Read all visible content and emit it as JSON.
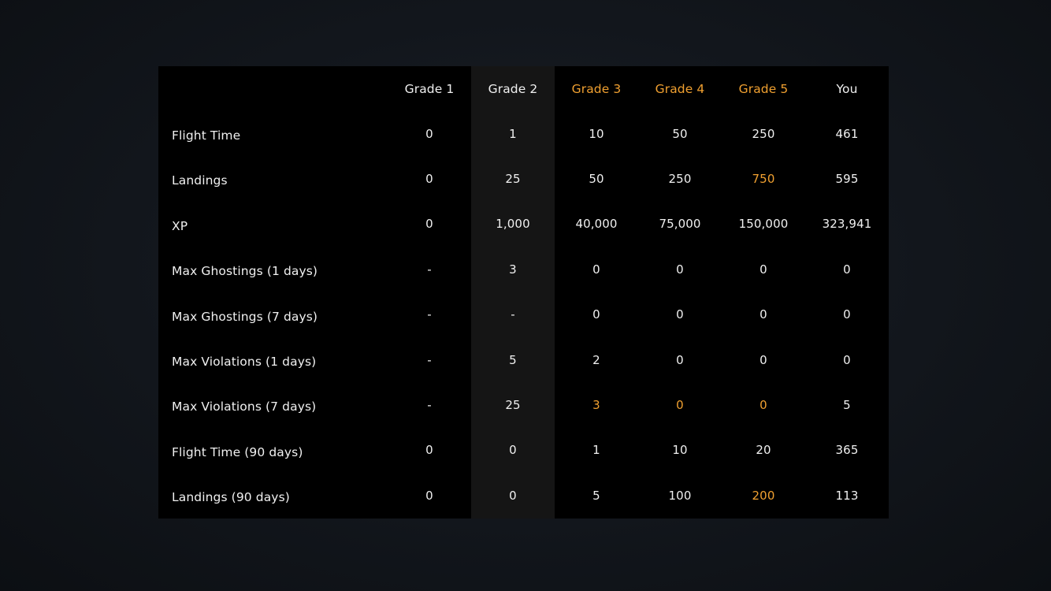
{
  "table": {
    "columns": [
      {
        "label": "Grade 1",
        "color": "#f0f0f0"
      },
      {
        "label": "Grade 2",
        "color": "#f0f0f0"
      },
      {
        "label": "Grade 3",
        "color": "#f0a030"
      },
      {
        "label": "Grade 4",
        "color": "#f0a030"
      },
      {
        "label": "Grade 5",
        "color": "#f0a030"
      },
      {
        "label": "You",
        "color": "#f0f0f0"
      }
    ],
    "highlight_color": "#f0a030",
    "rows": [
      {
        "label": "Flight Time",
        "values": [
          "0",
          "1",
          "10",
          "50",
          "250",
          "461"
        ],
        "highlight": []
      },
      {
        "label": "Landings",
        "values": [
          "0",
          "25",
          "50",
          "250",
          "750",
          "595"
        ],
        "highlight": [
          4
        ]
      },
      {
        "label": "XP",
        "values": [
          "0",
          "1,000",
          "40,000",
          "75,000",
          "150,000",
          "323,941"
        ],
        "highlight": []
      },
      {
        "label": "Max Ghostings (1 days)",
        "values": [
          "-",
          "3",
          "0",
          "0",
          "0",
          "0"
        ],
        "highlight": []
      },
      {
        "label": "Max Ghostings (7 days)",
        "values": [
          "-",
          "-",
          "0",
          "0",
          "0",
          "0"
        ],
        "highlight": []
      },
      {
        "label": "Max Violations (1 days)",
        "values": [
          "-",
          "5",
          "2",
          "0",
          "0",
          "0"
        ],
        "highlight": []
      },
      {
        "label": "Max Violations (7 days)",
        "values": [
          "-",
          "25",
          "3",
          "0",
          "0",
          "5"
        ],
        "highlight": [
          2,
          3,
          4
        ]
      },
      {
        "label": "Flight Time (90 days)",
        "values": [
          "0",
          "0",
          "1",
          "10",
          "20",
          "365"
        ],
        "highlight": []
      },
      {
        "label": "Landings (90 days)",
        "values": [
          "0",
          "0",
          "5",
          "100",
          "200",
          "113"
        ],
        "highlight": [
          4
        ]
      }
    ]
  }
}
